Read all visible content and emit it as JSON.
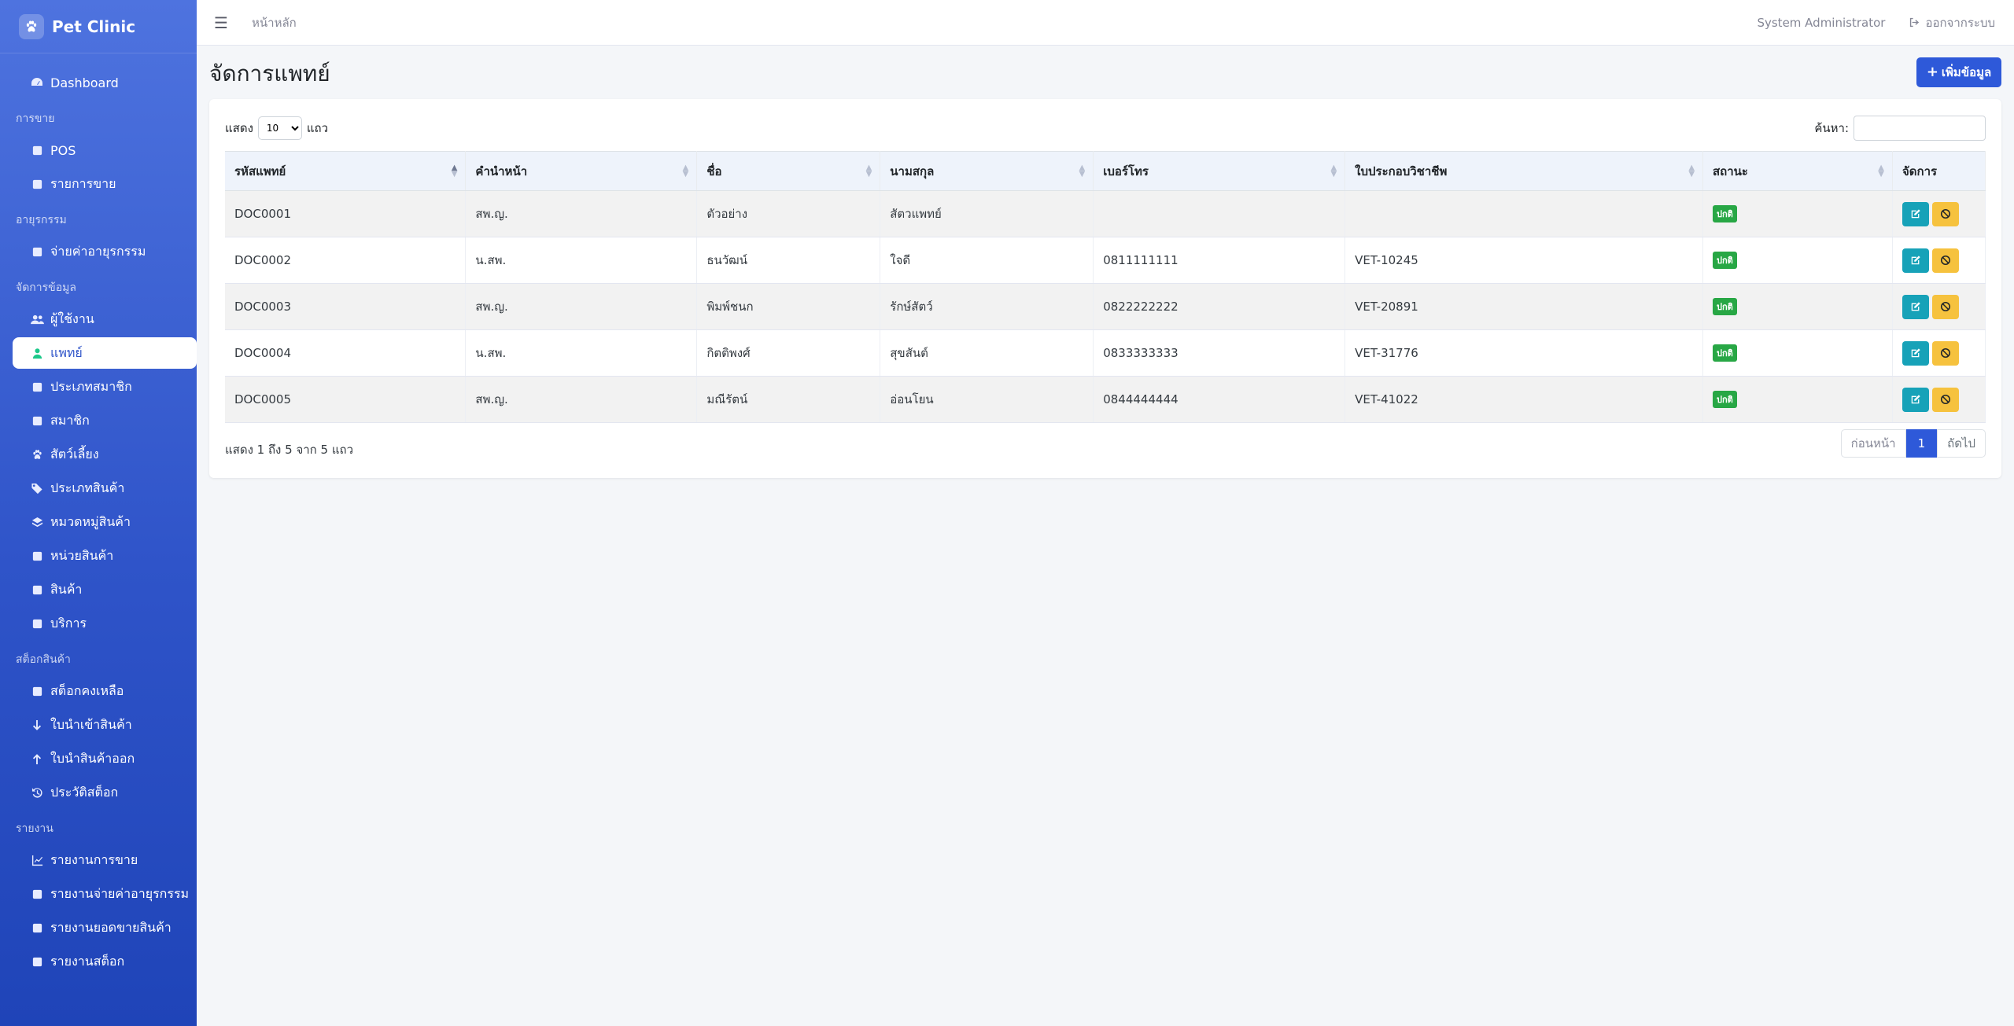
{
  "brand": {
    "name": "Pet Clinic",
    "icon": "paw-icon"
  },
  "sidebar": {
    "dashboard": "Dashboard",
    "sections": [
      {
        "label": "การขาย",
        "items": [
          {
            "label": "POS",
            "icon": "cash-register-icon"
          },
          {
            "label": "รายการขาย",
            "icon": "receipt-icon"
          }
        ]
      },
      {
        "label": "อายุรกรรม",
        "items": [
          {
            "label": "จ่ายค่าอายุรกรรม",
            "icon": "invoice-icon"
          }
        ]
      },
      {
        "label": "จัดการข้อมูล",
        "items": [
          {
            "label": "ผู้ใช้งาน",
            "icon": "users-icon"
          },
          {
            "label": "แพทย์",
            "icon": "doctor-icon",
            "active": true
          },
          {
            "label": "ประเภทสมาชิก",
            "icon": "id-card-icon"
          },
          {
            "label": "สมาชิก",
            "icon": "id-badge-icon"
          },
          {
            "label": "สัตว์เลี้ยง",
            "icon": "paw-icon"
          },
          {
            "label": "ประเภทสินค้า",
            "icon": "tags-icon"
          },
          {
            "label": "หมวดหมู่สินค้า",
            "icon": "layers-icon"
          },
          {
            "label": "หน่วยสินค้า",
            "icon": "ruler-icon"
          },
          {
            "label": "สินค้า",
            "icon": "box-icon"
          },
          {
            "label": "บริการ",
            "icon": "stethoscope-icon"
          }
        ]
      },
      {
        "label": "สต็อกสินค้า",
        "items": [
          {
            "label": "สต็อกคงเหลือ",
            "icon": "warehouse-icon"
          },
          {
            "label": "ใบนำเข้าสินค้า",
            "icon": "arrow-down-icon"
          },
          {
            "label": "ใบนำสินค้าออก",
            "icon": "arrow-up-icon"
          },
          {
            "label": "ประวัติสต็อก",
            "icon": "history-icon"
          }
        ]
      },
      {
        "label": "รายงาน",
        "items": [
          {
            "label": "รายงานการขาย",
            "icon": "chart-line-icon"
          },
          {
            "label": "รายงานจ่ายค่าอายุรกรรม",
            "icon": "hand-holding-icon"
          },
          {
            "label": "รายงานยอดขายสินค้า",
            "icon": "pills-icon"
          },
          {
            "label": "รายงานสต็อก",
            "icon": "clipboard-icon"
          }
        ]
      }
    ]
  },
  "header": {
    "breadcrumb": "หน้าหลัก",
    "user": "System Administrator",
    "logout": "ออกจากระบบ"
  },
  "page": {
    "title": "จัดการแพทย์",
    "add_button": "เพิ่มข้อมูล"
  },
  "table": {
    "length_prefix": "แสดง",
    "length_value": "10",
    "length_suffix": "แถว",
    "search_label": "ค้นหา:",
    "columns": [
      "รหัสแพทย์",
      "คำนำหน้า",
      "ชื่อ",
      "นามสกุล",
      "เบอร์โทร",
      "ใบประกอบวิชาชีพ",
      "สถานะ",
      "จัดการ"
    ],
    "rows": [
      {
        "code": "DOC0001",
        "prefix": "สพ.ญ.",
        "first": "ตัวอย่าง",
        "last": "สัตวแพทย์",
        "phone": "",
        "license": "",
        "status": "ปกติ"
      },
      {
        "code": "DOC0002",
        "prefix": "น.สพ.",
        "first": "ธนวัฒน์",
        "last": "ใจดี",
        "phone": "0811111111",
        "license": "VET-10245",
        "status": "ปกติ"
      },
      {
        "code": "DOC0003",
        "prefix": "สพ.ญ.",
        "first": "พิมพ์ชนก",
        "last": "รักษ์สัตว์",
        "phone": "0822222222",
        "license": "VET-20891",
        "status": "ปกติ"
      },
      {
        "code": "DOC0004",
        "prefix": "น.สพ.",
        "first": "กิตติพงศ์",
        "last": "สุขสันต์",
        "phone": "0833333333",
        "license": "VET-31776",
        "status": "ปกติ"
      },
      {
        "code": "DOC0005",
        "prefix": "สพ.ญ.",
        "first": "มณีรัตน์",
        "last": "อ่อนโยน",
        "phone": "0844444444",
        "license": "VET-41022",
        "status": "ปกติ"
      }
    ],
    "info": "แสดง 1 ถึง 5 จาก 5 แถว",
    "pager": {
      "prev": "ก่อนหน้า",
      "current": "1",
      "next": "ถัดไป"
    }
  },
  "colors": {
    "primary": "#2e59d9",
    "success": "#28a745",
    "info": "#17a2b8",
    "warning": "#f6c23e"
  }
}
